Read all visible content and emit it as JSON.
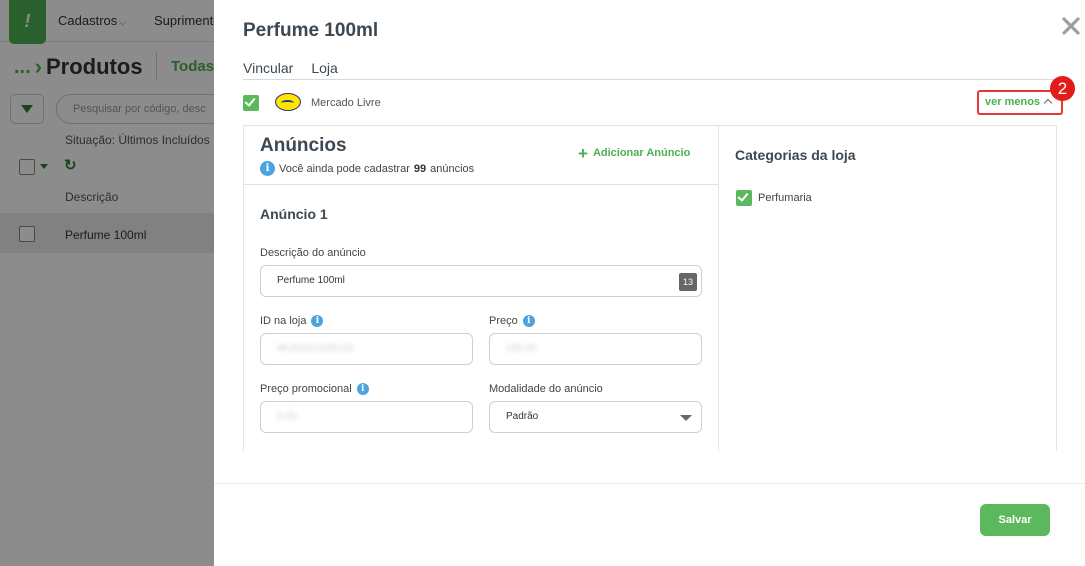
{
  "background": {
    "menu": [
      "Cadastros",
      "Suprimentos"
    ],
    "breadcrumb": {
      "dots": "...",
      "title": "Produtos"
    },
    "filter_tab": "Todas",
    "search_placeholder": "Pesquisar por código, desc",
    "situacao": "Situação: Últimos Incluídos",
    "column_header": "Descrição",
    "row_description": "Perfume 100ml"
  },
  "panel": {
    "title": "Perfume 100ml",
    "tabs": [
      "Vincular",
      "Loja"
    ],
    "store": {
      "name": "Mercado Livre",
      "checked": true,
      "toggle_label": "ver menos"
    },
    "step_badge": "2",
    "anuncios": {
      "title": "Anúncios",
      "info_prefix": "Você ainda pode cadastrar",
      "info_count": "99",
      "info_suffix": "anúncios",
      "add_label": "Adicionar Anúncio"
    },
    "anuncio": {
      "title": "Anúncio 1",
      "descricao_label": "Descrição do anúncio",
      "descricao_value": "Perfume 100ml",
      "descricao_count": "13",
      "id_label": "ID na loja",
      "id_value": "MLB1012345123",
      "preco_label": "Preço",
      "preco_value": "150,00",
      "preco_promo_label": "Preço promocional",
      "preco_promo_value": "0,00",
      "modalidade_label": "Modalidade do anúncio",
      "modalidade_value": "Padrão"
    },
    "categorias": {
      "title": "Categorias da loja",
      "items": [
        {
          "label": "Perfumaria",
          "checked": true
        }
      ]
    },
    "save_label": "Salvar"
  },
  "colors": {
    "accent_green": "#4caf50",
    "button_green": "#5cb85c",
    "highlight_red": "#e53935",
    "info_blue": "#4ba3e0"
  }
}
